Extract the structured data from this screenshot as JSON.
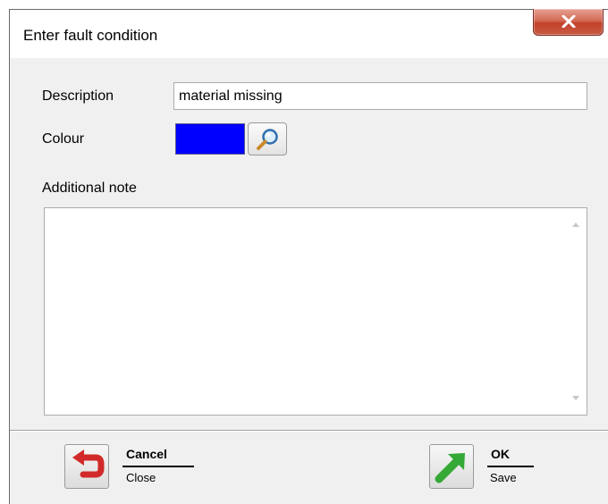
{
  "dialog": {
    "title": "Enter fault condition"
  },
  "form": {
    "description_label": "Description",
    "description_value": "material missing",
    "colour_label": "Colour",
    "colour_value": "#0000ff",
    "additional_note_label": "Additional note",
    "additional_note_value": ""
  },
  "actions": {
    "cancel": {
      "label": "Cancel",
      "sublabel": "Close",
      "icon": "undo-arrow-icon"
    },
    "ok": {
      "label": "OK",
      "sublabel": "Save",
      "icon": "green-arrow-icon"
    }
  },
  "colors": {
    "swatch": "#0000ff",
    "close_button": "#c2412a"
  }
}
